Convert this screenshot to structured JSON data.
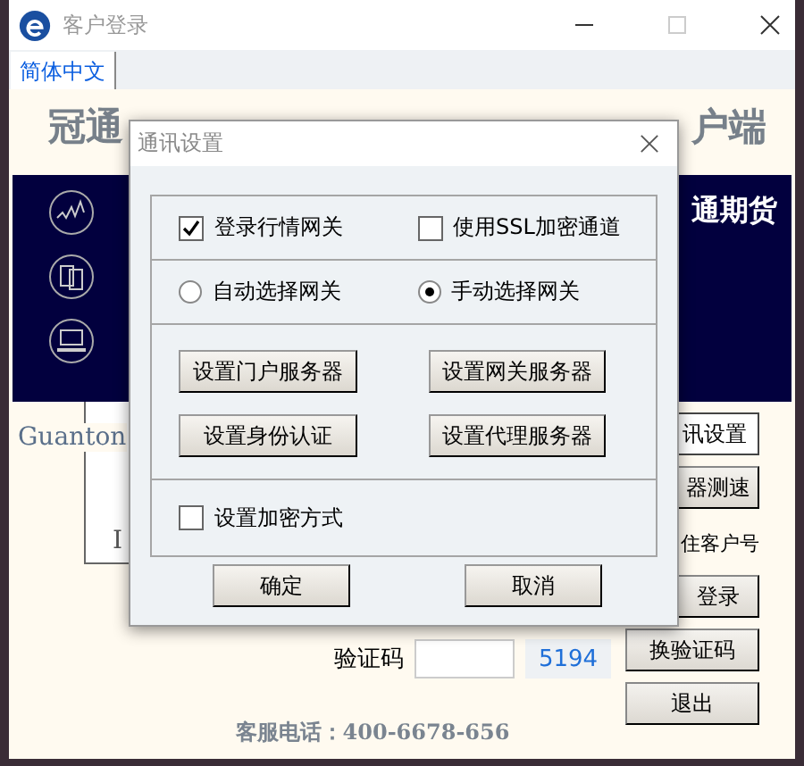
{
  "window": {
    "title": "客户登录"
  },
  "tabs": [
    {
      "label": "简体中文",
      "selected": true
    }
  ],
  "banner": {
    "title_left": "冠通",
    "title_right": "户端",
    "band_text": "通期货"
  },
  "side_text": {
    "logo_fragment": "Guanton",
    "fragment": "I"
  },
  "right_column": [
    {
      "label": "讯设置",
      "kind": "field"
    },
    {
      "label": "器测速",
      "kind": "button"
    },
    {
      "label": "住客户号",
      "kind": "text"
    },
    {
      "label": "登录",
      "kind": "button"
    },
    {
      "label": "换验证码",
      "kind": "button"
    },
    {
      "label": "退出",
      "kind": "button"
    }
  ],
  "captcha": {
    "label": "验证码",
    "code": "5194"
  },
  "footer": "客服电话：400-6678-656",
  "dialog": {
    "title": "通讯设置",
    "options": [
      {
        "label": "登录行情网关",
        "checked": true
      },
      {
        "label": "使用SSL加密通道",
        "checked": false
      }
    ],
    "gateway_modes": [
      {
        "label": "自动选择网关",
        "selected": false
      },
      {
        "label": "手动选择网关",
        "selected": true
      }
    ],
    "server_buttons": [
      "设置门户服务器",
      "设置网关服务器",
      "设置身份认证",
      "设置代理服务器"
    ],
    "encryption": {
      "label": "设置加密方式",
      "checked": false
    },
    "buttons": [
      "确定",
      "取消"
    ]
  }
}
